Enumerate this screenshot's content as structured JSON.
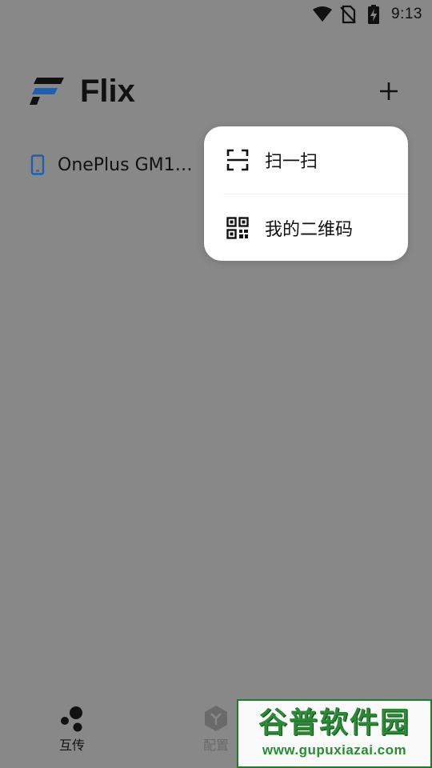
{
  "status_bar": {
    "time": "9:13",
    "icons": [
      "wifi-icon",
      "no-sim-icon",
      "battery-charging-icon"
    ]
  },
  "header": {
    "title": "Flix",
    "logo": "flix-logo",
    "add_icon": "plus-icon"
  },
  "devices": [
    {
      "name": "OnePlus GM19…",
      "icon": "phone-icon"
    }
  ],
  "popup_menu": {
    "items": [
      {
        "label": "扫一扫",
        "icon": "scan-icon"
      },
      {
        "label": "我的二维码",
        "icon": "qr-code-icon"
      }
    ]
  },
  "bottom_nav": {
    "items": [
      {
        "label": "互传",
        "icon": "transfer-icon",
        "active": true
      },
      {
        "label": "配置",
        "icon": "config-icon",
        "active": false
      }
    ]
  },
  "watermark": {
    "title": "谷普软件园",
    "url": "www.gupuxiazai.com"
  },
  "colors": {
    "overlay_background": "#888888",
    "popup_background": "#ffffff",
    "brand_blue": "#1e5fb0",
    "text_primary": "#111111",
    "watermark_green": "#2a8a35"
  }
}
